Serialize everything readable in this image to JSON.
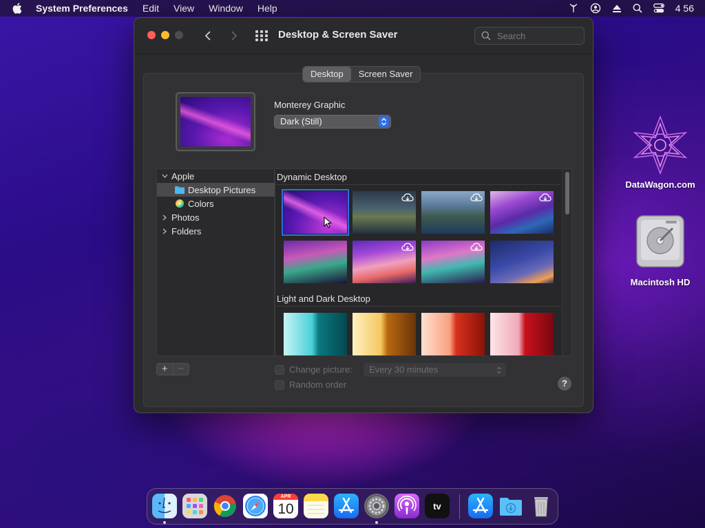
{
  "menubar": {
    "app_name": "System Preferences",
    "menus": [
      "Edit",
      "View",
      "Window",
      "Help"
    ],
    "clock": "4 56"
  },
  "window": {
    "title": "Desktop & Screen Saver",
    "search_placeholder": "Search",
    "tabs": [
      {
        "label": "Desktop",
        "active": true
      },
      {
        "label": "Screen Saver",
        "active": false
      }
    ],
    "wallpaper_name": "Monterey Graphic",
    "style_value": "Dark (Still)"
  },
  "sources": {
    "apple": "Apple",
    "desktop_pictures": "Desktop Pictures",
    "colors": "Colors",
    "photos": "Photos",
    "folders": "Folders"
  },
  "browser": {
    "section1": "Dynamic Desktop",
    "section2": "Light and Dark Desktop"
  },
  "options": {
    "change_picture_label": "Change picture:",
    "interval_value": "Every 30 minutes",
    "random_order_label": "Random order",
    "help": "?"
  },
  "desktop": {
    "icon1_label": "DataWagon.com",
    "icon2_label": "Macintosh HD"
  },
  "dock_apps": [
    "Finder",
    "Launchpad",
    "Chrome",
    "Safari",
    "Calendar",
    "Notes",
    "App Store",
    "System Preferences",
    "Podcasts",
    "TV",
    "App Store",
    "Downloads",
    "Trash"
  ],
  "calendar": {
    "month": "APR",
    "day": "10"
  },
  "tv_label": "tv"
}
